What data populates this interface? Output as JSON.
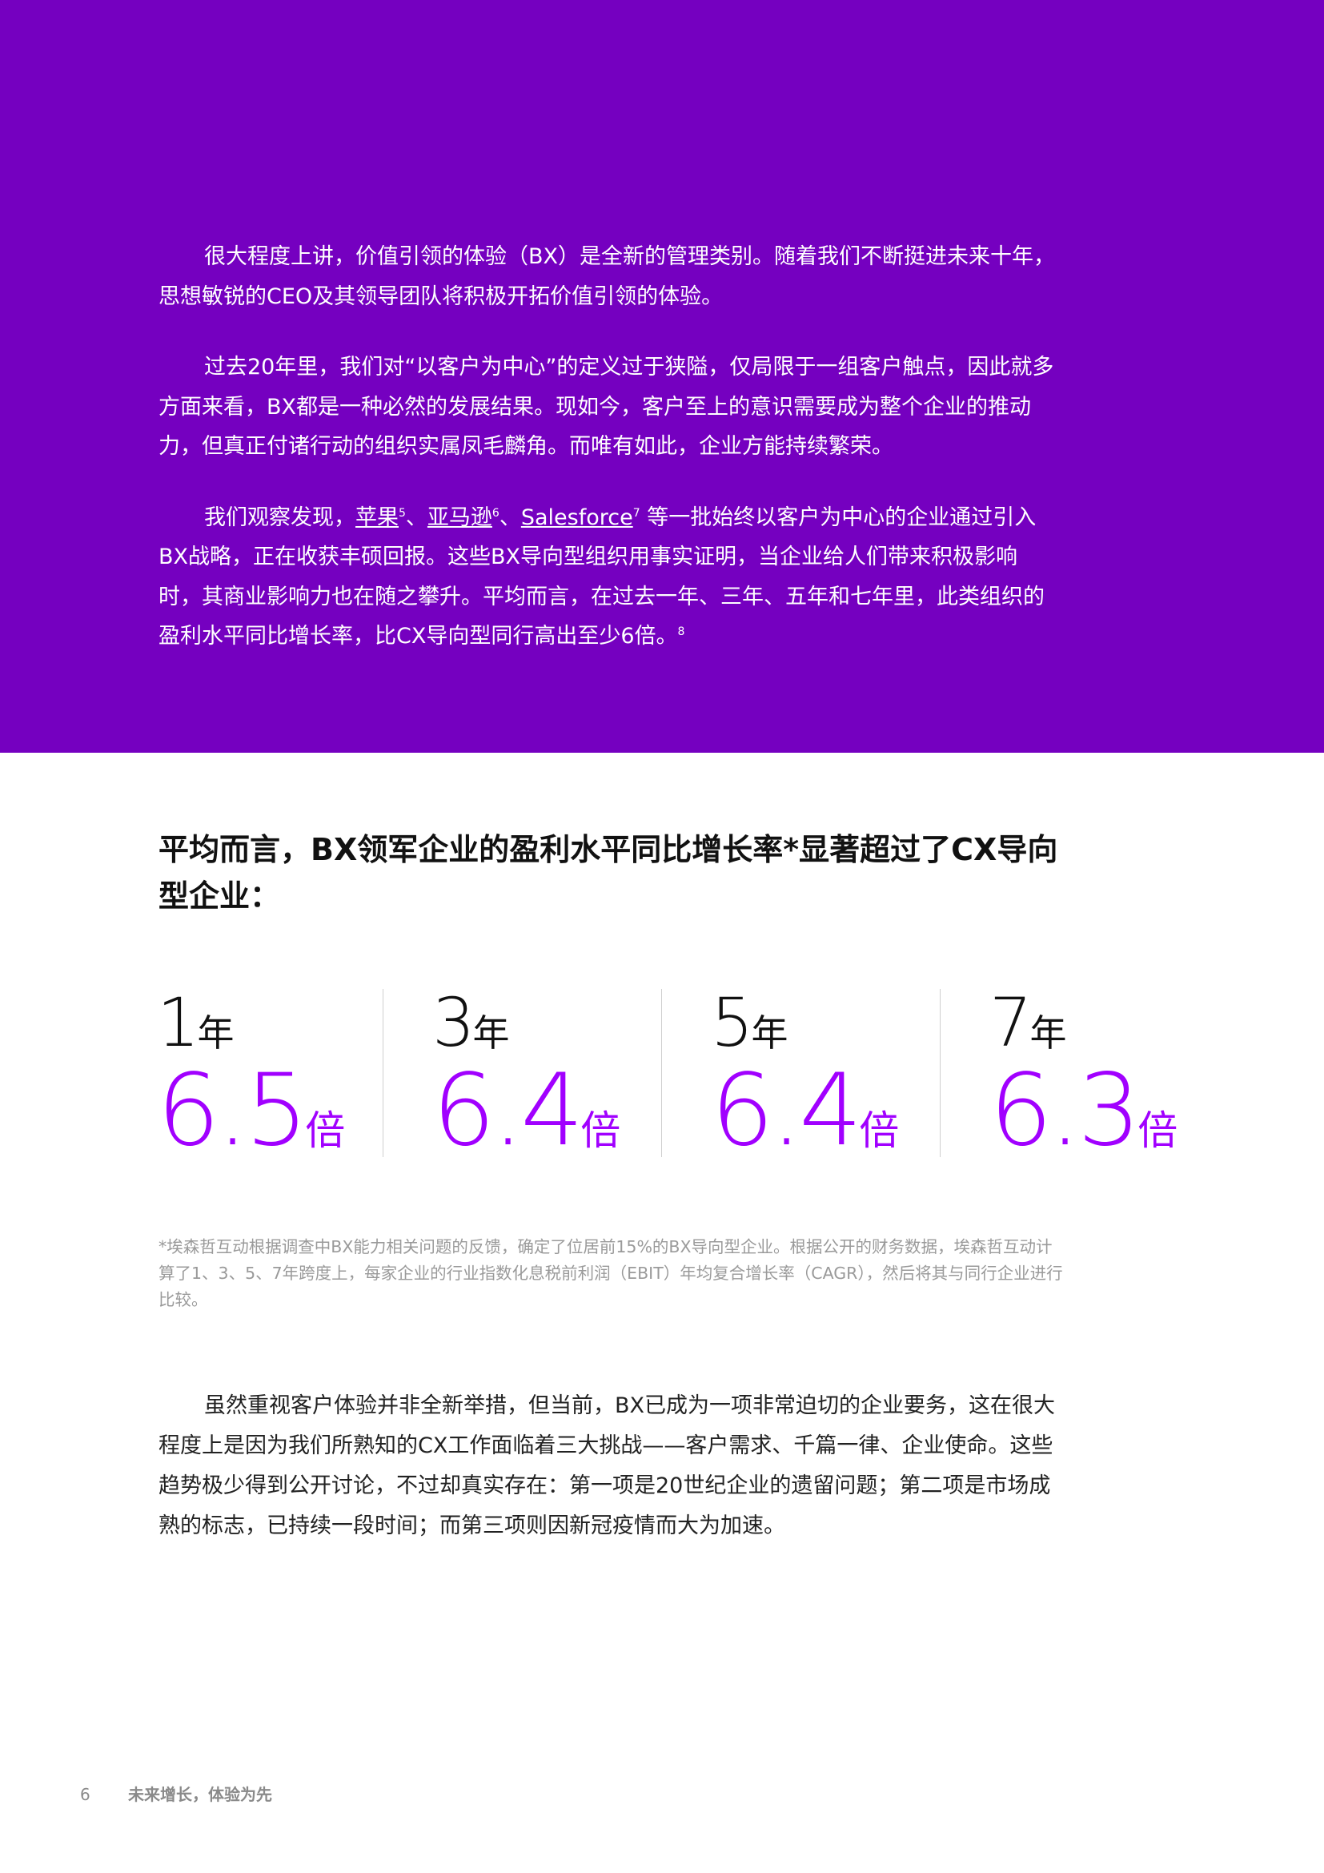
{
  "hero": {
    "p1": "很大程度上讲，价值引领的体验（BX）是全新的管理类别。随着我们不断挺进未来十年，思想敏锐的CEO及其领导团队将积极开拓价值引领的体验。",
    "p2": "过去20年里，我们对“以客户为中心”的定义过于狭隘，仅局限于一组客户触点，因此就多方面来看，BX都是一种必然的发展结果。现如今，客户至上的意识需要成为整个企业的推动力，但真正付诸行动的组织实属凤毛麟角。而唯有如此，企业方能持续繁荣。",
    "p3": {
      "lead": "我们观察发现，",
      "apple": "苹果",
      "apple_ref": "5",
      "sep1": "、",
      "amazon": "亚马逊",
      "amazon_ref": "6",
      "sep2": "、",
      "salesforce": "Salesforce",
      "salesforce_ref": "7",
      "rest": " 等一批始终以客户为中心的企业通过引入BX战略，正在收获丰硕回报。这些BX导向型组织用事实证明，当企业给人们带来积极影响时，其商业影响力也在随之攀升。平均而言，在过去一年、三年、五年和七年里，此类组织的盈利水平同比增长率，比CX导向型同行高出至少6倍。",
      "end_ref": "8"
    }
  },
  "heading": "平均而言，BX领军企业的盈利水平同比增长率*显著超过了CX导向型企业：",
  "stats": [
    {
      "year": "1",
      "year_unit": "年",
      "multiple": "6.5",
      "multiple_unit": "倍"
    },
    {
      "year": "3",
      "year_unit": "年",
      "multiple": "6.4",
      "multiple_unit": "倍"
    },
    {
      "year": "5",
      "year_unit": "年",
      "multiple": "6.4",
      "multiple_unit": "倍"
    },
    {
      "year": "7",
      "year_unit": "年",
      "multiple": "6.3",
      "multiple_unit": "倍"
    }
  ],
  "footnote": "*埃森哲互动根据调查中BX能力相关问题的反馈，确定了位居前15%的BX导向型企业。根据公开的财务数据，埃森哲互动计算了1、3、5、7年跨度上，每家企业的行业指数化息税前利润（EBIT）年均复合增长率（CAGR），然后将其与同行企业进行比较。",
  "body": "虽然重视客户体验并非全新举措，但当前，BX已成为一项非常迫切的企业要务，这在很大程度上是因为我们所熟知的CX工作面临着三大挑战——客户需求、千篇一律、企业使命。这些趋势极少得到公开讨论，不过却真实存在：第一项是20世纪企业的遗留问题；第二项是市场成熟的标志，已持续一段时间；而第三项则因新冠疫情而大为加速。",
  "footer": {
    "page_number": "6",
    "title": "未来增长，体验为先"
  },
  "colors": {
    "hero_background": "#7500c0",
    "stat_accent": "#a100ff"
  }
}
